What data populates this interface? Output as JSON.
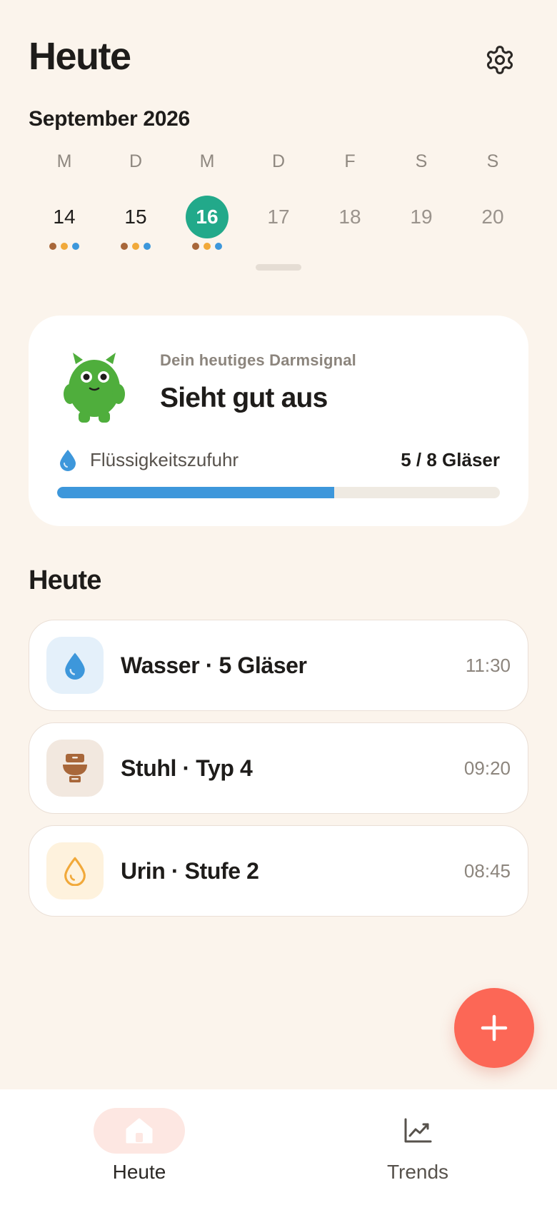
{
  "header": {
    "title": "Heute",
    "settings_icon": "gear-icon"
  },
  "calendar": {
    "month": "September 2026",
    "days": [
      {
        "letter": "M",
        "number": "14",
        "state": "past",
        "dots": [
          "#A8673A",
          "#F1A93A",
          "#3D97DB"
        ]
      },
      {
        "letter": "D",
        "number": "15",
        "state": "past",
        "dots": [
          "#A8673A",
          "#F1A93A",
          "#3D97DB"
        ]
      },
      {
        "letter": "M",
        "number": "16",
        "state": "selected",
        "dots": [
          "#A8673A",
          "#F1A93A",
          "#3D97DB"
        ]
      },
      {
        "letter": "D",
        "number": "17",
        "state": "future",
        "dots": []
      },
      {
        "letter": "F",
        "number": "18",
        "state": "future",
        "dots": []
      },
      {
        "letter": "S",
        "number": "19",
        "state": "future",
        "dots": []
      },
      {
        "letter": "S",
        "number": "20",
        "state": "future",
        "dots": []
      }
    ]
  },
  "signal_card": {
    "subtitle": "Dein heutiges Darmsignal",
    "title": "Sieht gut aus",
    "mascot_icon": "green-monster-mascot-icon",
    "hydration": {
      "icon": "water-drop-icon",
      "label": "Flüssigkeitszufuhr",
      "value": "5 / 8 Gläser",
      "progress": 0.625
    }
  },
  "section": {
    "title": "Heute"
  },
  "entries": [
    {
      "title": "Wasser · 5 Gläser",
      "time": "11:30",
      "icon": "water-drop-icon",
      "icon_bg": "#E4F0FA"
    },
    {
      "title": "Stuhl · Typ 4",
      "time": "09:20",
      "icon": "toilet-icon",
      "icon_bg": "#F2E8DF"
    },
    {
      "title": "Urin · Stufe 2",
      "time": "08:45",
      "icon": "urine-drop-icon",
      "icon_bg": "#FEF2DD"
    }
  ],
  "fab": {
    "icon": "plus-icon"
  },
  "nav": [
    {
      "label": "Heute",
      "icon": "home-icon",
      "active": true
    },
    {
      "label": "Trends",
      "icon": "trend-chart-icon",
      "active": false
    }
  ],
  "colors": {
    "background": "#FBF4EC",
    "accent_green": "#22A98A",
    "water_blue": "#3D97DB",
    "stool_brown": "#A8673A",
    "urine_amber": "#F1A93A",
    "fab_red": "#FC6756"
  }
}
